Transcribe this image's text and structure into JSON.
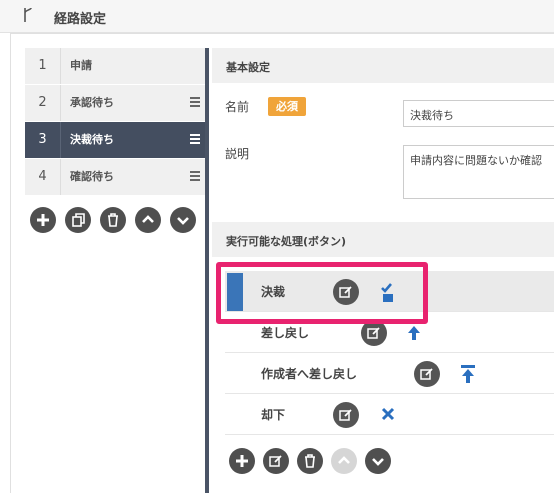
{
  "header": {
    "title": "経路設定",
    "icon": "branch-icon"
  },
  "steps": [
    {
      "num": "1",
      "label": "申請",
      "draggable": false
    },
    {
      "num": "2",
      "label": "承認待ち",
      "draggable": true
    },
    {
      "num": "3",
      "label": "決裁待ち",
      "draggable": true,
      "active": true
    },
    {
      "num": "4",
      "label": "確認待ち",
      "draggable": true
    }
  ],
  "step_tools": {
    "add": "+",
    "copy": "copy-icon",
    "delete": "trash-icon",
    "up": "chevron-up-icon",
    "down": "chevron-down-icon"
  },
  "basic": {
    "section_title": "基本設定",
    "name_label": "名前",
    "required_badge": "必須",
    "name_value": "決裁待ち",
    "desc_label": "説明",
    "desc_value": "申請内容に問題ないか確認"
  },
  "actions": {
    "section_title": "実行可能な処理(ボタン)",
    "items": [
      {
        "label": "決裁",
        "icon": "approve-icon",
        "selected": true
      },
      {
        "label": "差し戻し",
        "icon": "arrow-up-icon"
      },
      {
        "label": "作成者へ差し戻し",
        "icon": "arrow-to-top-icon"
      },
      {
        "label": "却下",
        "icon": "x-icon"
      }
    ]
  },
  "colors": {
    "highlight": "#e8236f",
    "active": "#444e60",
    "badge": "#f0a43a",
    "accent": "#2a6fbf"
  }
}
